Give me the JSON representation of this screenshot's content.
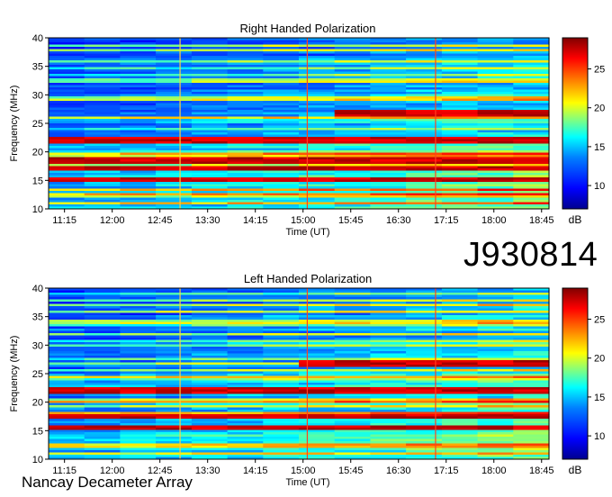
{
  "observation_id": "J930814",
  "instrument": "Nancay Decameter Array",
  "chart_data": [
    {
      "type": "heatmap",
      "title": "Right Handed Polarization",
      "xlabel": "Time (UT)",
      "ylabel": "Frequency (MHz)",
      "x_ticks": [
        "11:15",
        "12:00",
        "12:45",
        "13:30",
        "14:15",
        "15:00",
        "15:45",
        "16:30",
        "17:15",
        "18:00",
        "18:45"
      ],
      "y_ticks": [
        10,
        15,
        20,
        25,
        30,
        35,
        40
      ],
      "ylim": [
        10,
        40
      ],
      "colorbar": {
        "label": "dB",
        "ticks": [
          10,
          15,
          20,
          25
        ],
        "range": [
          7,
          29
        ]
      },
      "markers_time": [
        "13:04",
        "15:04",
        "17:05"
      ],
      "bands_mhz": [
        {
          "f": 26.8,
          "level": "strong",
          "from": "16:00",
          "to": "18:52"
        },
        {
          "f": 22.0,
          "level": "strong",
          "from": "11:00",
          "to": "18:52"
        },
        {
          "f": 18.5,
          "level": "strong",
          "from": "11:00",
          "to": "18:52"
        },
        {
          "f": 17.0,
          "level": "strong",
          "from": "11:00",
          "to": "18:52"
        },
        {
          "f": 15.0,
          "level": "strong",
          "from": "11:00",
          "to": "18:52"
        }
      ]
    },
    {
      "type": "heatmap",
      "title": "Left Handed Polarization",
      "xlabel": "Time (UT)",
      "ylabel": "Frequency (MHz)",
      "x_ticks": [
        "11:15",
        "12:00",
        "12:45",
        "13:30",
        "14:15",
        "15:00",
        "15:45",
        "16:30",
        "17:15",
        "18:00",
        "18:45"
      ],
      "y_ticks": [
        10,
        15,
        20,
        25,
        30,
        35,
        40
      ],
      "ylim": [
        10,
        40
      ],
      "colorbar": {
        "label": "dB",
        "ticks": [
          10,
          15,
          20,
          25
        ],
        "range": [
          7,
          29
        ]
      },
      "markers_time": [
        "13:04",
        "15:04",
        "17:05"
      ],
      "bands_mhz": [
        {
          "f": 26.8,
          "level": "strong",
          "from": "15:05",
          "to": "18:52"
        },
        {
          "f": 22.0,
          "level": "strong",
          "from": "11:00",
          "to": "18:52"
        },
        {
          "f": 17.5,
          "level": "strong",
          "from": "11:00",
          "to": "18:52"
        },
        {
          "f": 15.5,
          "level": "strong",
          "from": "11:00",
          "to": "18:52"
        }
      ]
    }
  ],
  "colors": {
    "colormap": [
      "#00008f",
      "#0000ff",
      "#0080ff",
      "#00ffff",
      "#80ff80",
      "#ffff00",
      "#ff8000",
      "#ff0000",
      "#800000"
    ]
  }
}
